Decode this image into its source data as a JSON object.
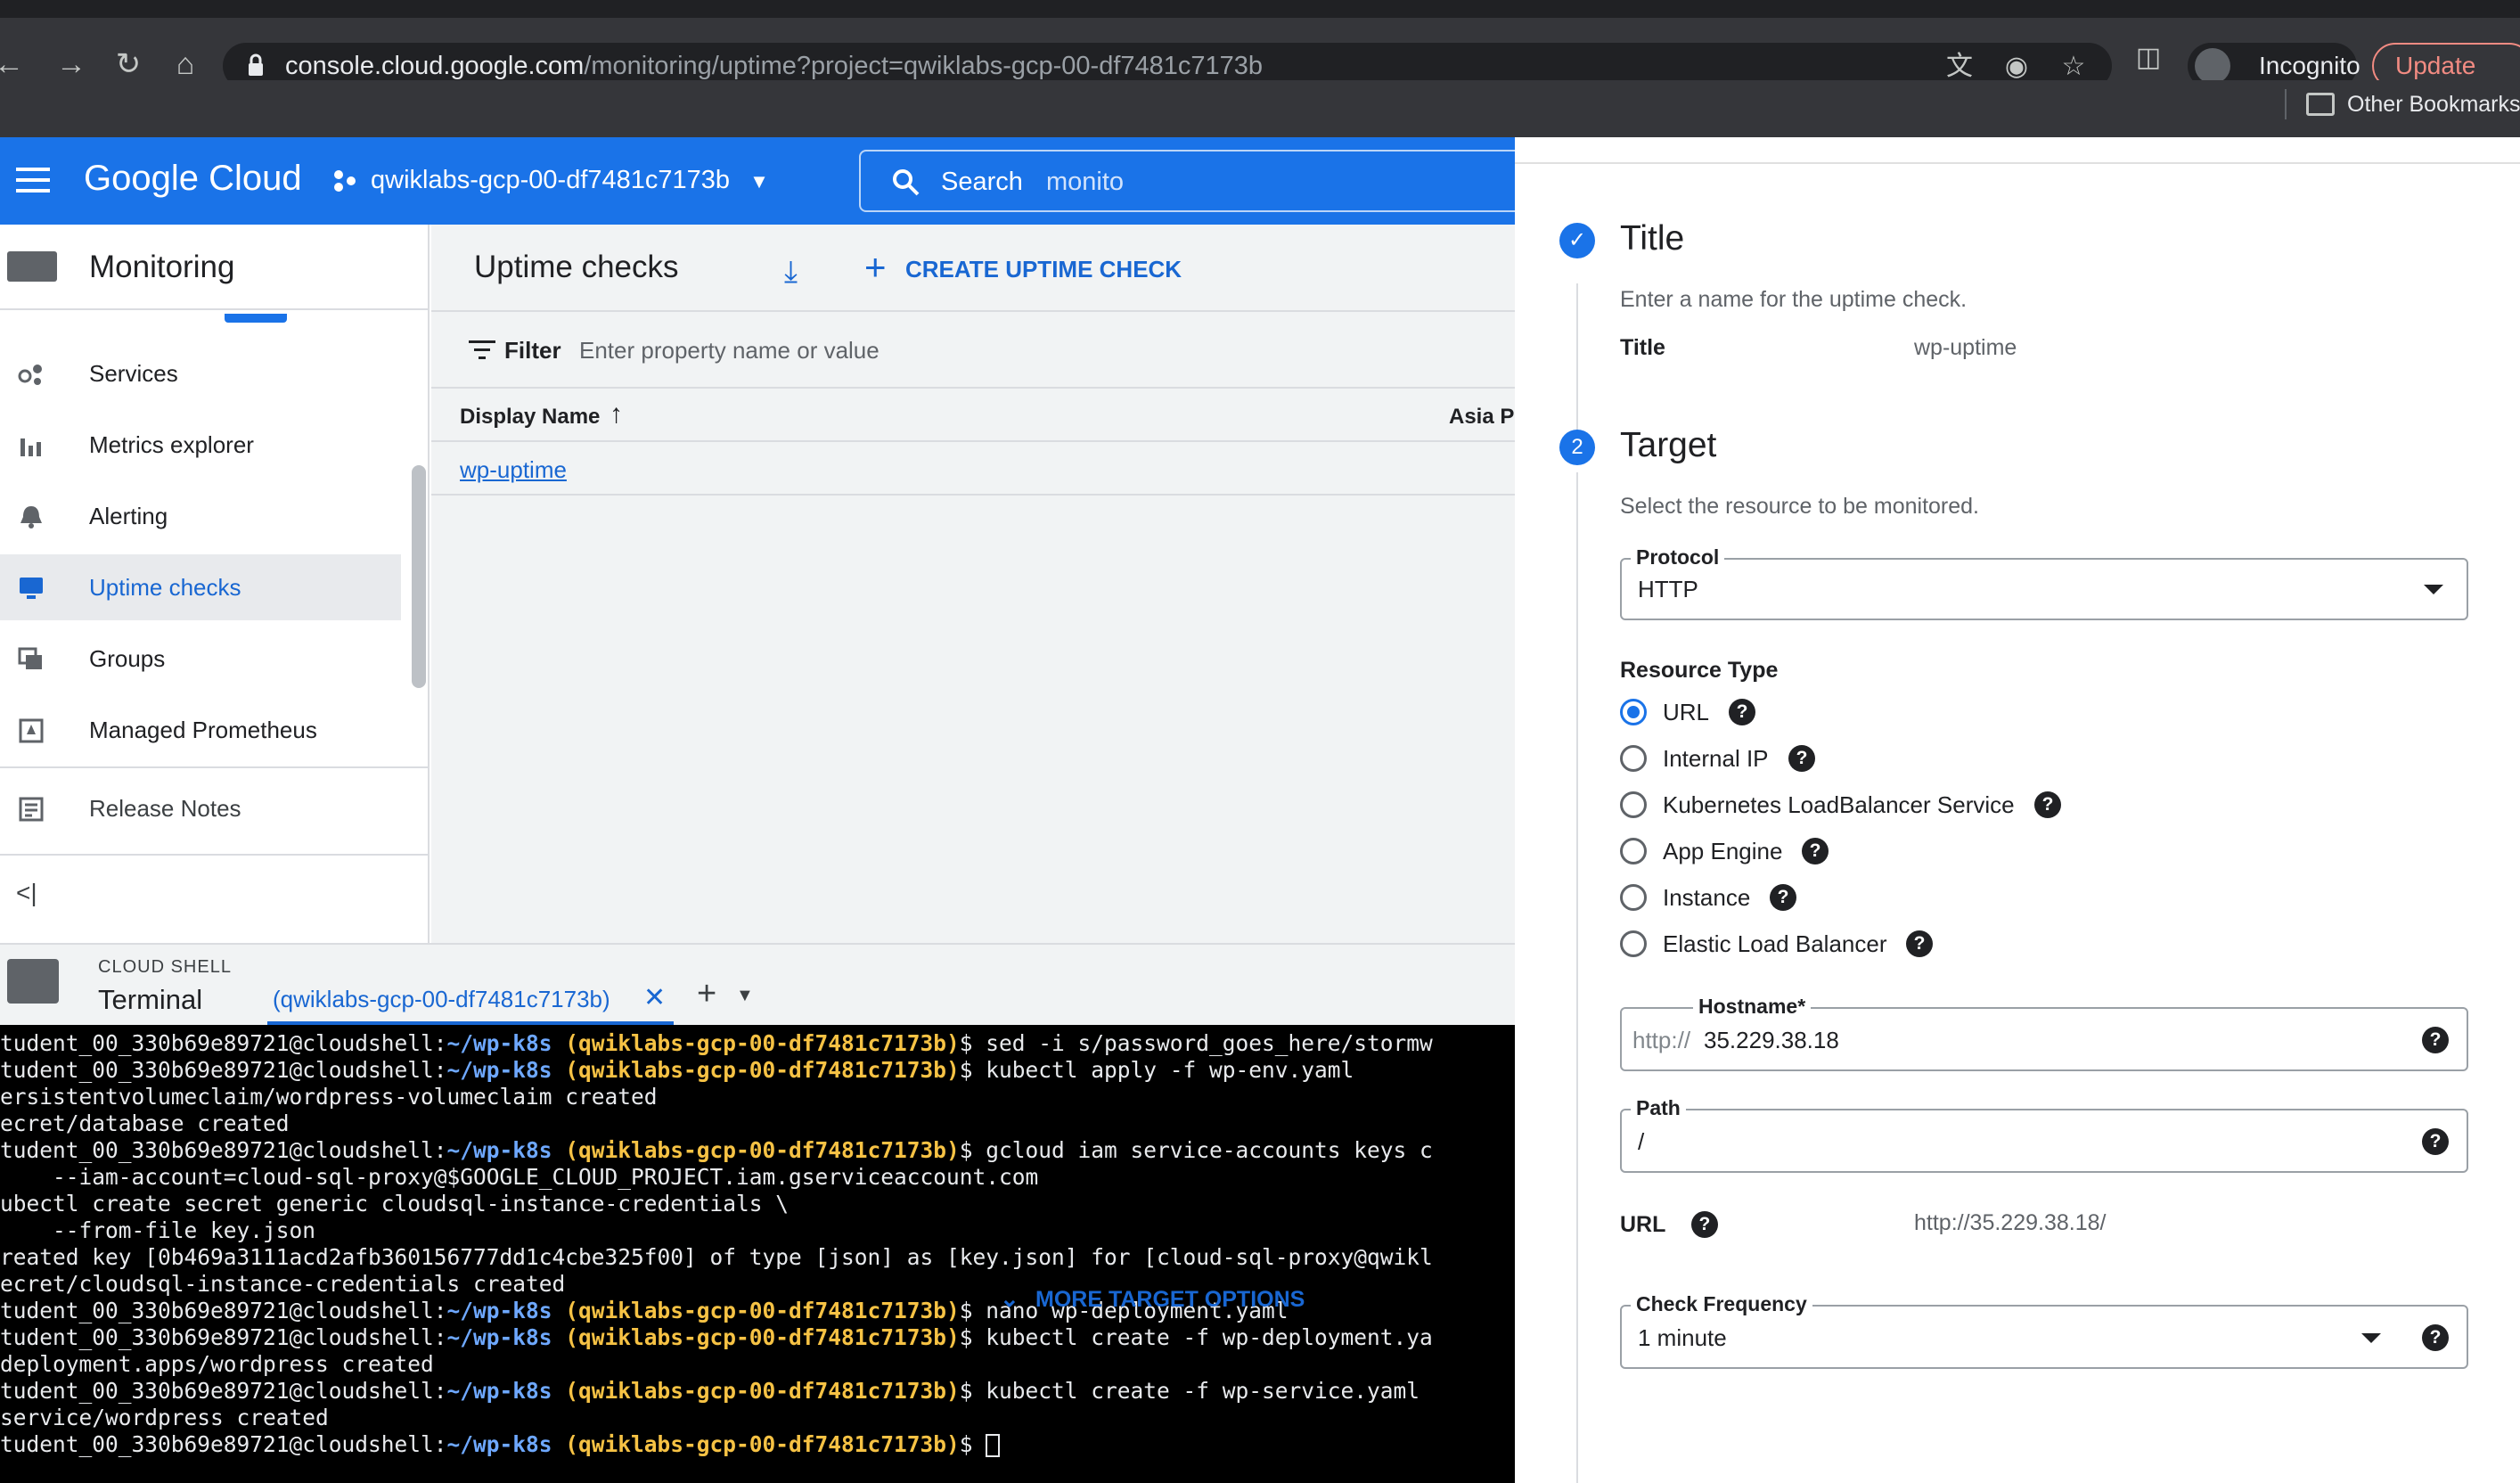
{
  "browser": {
    "url_host": "console.cloud.google.com",
    "url_path": "/monitoring/uptime?project=qwiklabs-gcp-00-df7481c7173b",
    "incognito_label": "Incognito",
    "update_label": "Update",
    "other_bookmarks": "Other Bookmarks"
  },
  "header": {
    "logo": "Google Cloud",
    "project": "qwiklabs-gcp-00-df7481c7173b",
    "search_label": "Search",
    "search_value": "monito"
  },
  "leftnav": {
    "title": "Monitoring",
    "items": [
      {
        "label": "Services",
        "icon": "services-icon"
      },
      {
        "label": "Metrics explorer",
        "icon": "bar-chart-icon"
      },
      {
        "label": "Alerting",
        "icon": "bell-icon"
      },
      {
        "label": "Uptime checks",
        "icon": "monitor-icon",
        "active": true
      },
      {
        "label": "Groups",
        "icon": "groups-icon"
      },
      {
        "label": "Managed Prometheus",
        "icon": "prometheus-icon"
      }
    ],
    "release_notes": "Release Notes",
    "collapse": "<|"
  },
  "main": {
    "title": "Uptime checks",
    "create_label": "CREATE UPTIME CHECK",
    "filter_label": "Filter",
    "filter_placeholder": "Enter property name or value",
    "col_display": "Display Name",
    "col_asia": "Asia Pa",
    "row_name": "wp-uptime"
  },
  "shell": {
    "small_label": "CLOUD SHELL",
    "big_label": "Terminal",
    "tab_label": "(qwiklabs-gcp-00-df7481c7173b)",
    "lines": [
      {
        "user": "tudent_00_330b69e89721@cloudshell:",
        "path": "~/wp-k8s",
        "proj": " (qwiklabs-gcp-00-df7481c7173b)",
        "cmd": "$ sed -i s/password_goes_here/stormw"
      },
      {
        "user": "tudent_00_330b69e89721@cloudshell:",
        "path": "~/wp-k8s",
        "proj": " (qwiklabs-gcp-00-df7481c7173b)",
        "cmd": "$ kubectl apply -f wp-env.yaml"
      },
      {
        "text": "ersistentvolumeclaim/wordpress-volumeclaim created"
      },
      {
        "text": "ecret/database created"
      },
      {
        "user": "tudent_00_330b69e89721@cloudshell:",
        "path": "~/wp-k8s",
        "proj": " (qwiklabs-gcp-00-df7481c7173b)",
        "cmd": "$ gcloud iam service-accounts keys c"
      },
      {
        "text": "    --iam-account=cloud-sql-proxy@$GOOGLE_CLOUD_PROJECT.iam.gserviceaccount.com"
      },
      {
        "text": "ubectl create secret generic cloudsql-instance-credentials \\"
      },
      {
        "text": "    --from-file key.json"
      },
      {
        "text": "reated key [0b469a3111acd2afb360156777dd1c4cbe325f00] of type [json] as [key.json] for [cloud-sql-proxy@qwikl"
      },
      {
        "text": "ecret/cloudsql-instance-credentials created"
      },
      {
        "user": "tudent_00_330b69e89721@cloudshell:",
        "path": "~/wp-k8s",
        "proj": " (qwiklabs-gcp-00-df7481c7173b)",
        "cmd": "$ nano wp-deployment.yaml"
      },
      {
        "user": "tudent_00_330b69e89721@cloudshell:",
        "path": "~/wp-k8s",
        "proj": " (qwiklabs-gcp-00-df7481c7173b)",
        "cmd": "$ kubectl create -f wp-deployment.ya"
      },
      {
        "text": "deployment.apps/wordpress created"
      },
      {
        "user": "tudent_00_330b69e89721@cloudshell:",
        "path": "~/wp-k8s",
        "proj": " (qwiklabs-gcp-00-df7481c7173b)",
        "cmd": "$ kubectl create -f wp-service.yaml"
      },
      {
        "text": "service/wordpress created"
      },
      {
        "user": "tudent_00_330b69e89721@cloudshell:",
        "path": "~/wp-k8s",
        "proj": " (qwiklabs-gcp-00-df7481c7173b)",
        "cmd": "$ ",
        "cursor": true
      }
    ]
  },
  "panel": {
    "title_step": {
      "heading": "Title",
      "subtitle": "Enter a name for the uptime check.",
      "field_label": "Title",
      "field_value": "wp-uptime"
    },
    "target_step": {
      "number": "2",
      "heading": "Target",
      "subtitle": "Select the resource to be monitored.",
      "protocol_label": "Protocol",
      "protocol_value": "HTTP",
      "resource_type_label": "Resource Type",
      "resource_types": [
        {
          "label": "URL",
          "selected": true
        },
        {
          "label": "Internal IP",
          "selected": false
        },
        {
          "label": "Kubernetes LoadBalancer Service",
          "selected": false
        },
        {
          "label": "App Engine",
          "selected": false
        },
        {
          "label": "Instance",
          "selected": false
        },
        {
          "label": "Elastic Load Balancer",
          "selected": false
        }
      ],
      "hostname_label": "Hostname*",
      "hostname_prefix": "http://",
      "hostname_value": "35.229.38.18",
      "path_label": "Path",
      "path_value": "/",
      "url_label": "URL",
      "url_value": "http://35.229.38.18/",
      "frequency_label": "Check Frequency",
      "frequency_value": "1 minute",
      "more_options": "MORE TARGET OPTIONS"
    },
    "help_glyph": "?"
  },
  "colors": {
    "brand_blue": "#1a73e8",
    "link_blue": "#1967d2",
    "terminal_path": "#6ea8ff",
    "terminal_project": "#f6c244"
  }
}
